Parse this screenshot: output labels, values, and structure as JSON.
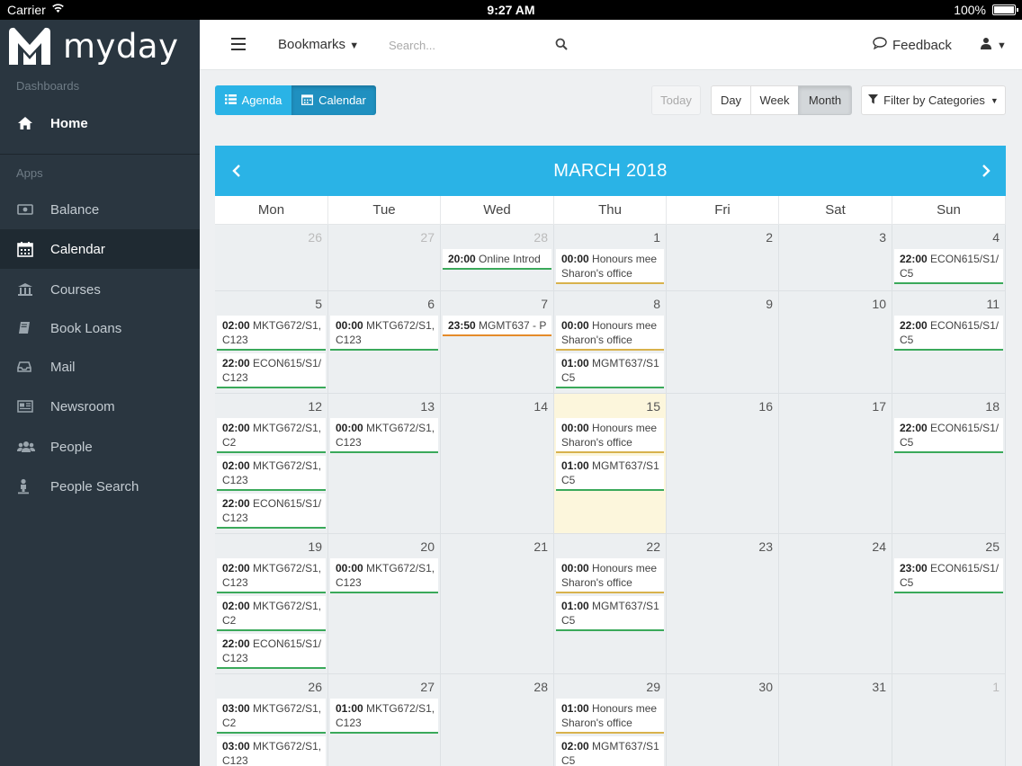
{
  "status_bar": {
    "carrier": "Carrier",
    "time": "9:27 AM",
    "battery": "100%"
  },
  "sidebar": {
    "logo_text": "myday",
    "dashboards_label": "Dashboards",
    "home_label": "Home",
    "apps_label": "Apps",
    "items": [
      {
        "label": "Balance",
        "icon": "balance-icon"
      },
      {
        "label": "Calendar",
        "icon": "calendar-icon"
      },
      {
        "label": "Courses",
        "icon": "courses-icon"
      },
      {
        "label": "Book Loans",
        "icon": "book-icon"
      },
      {
        "label": "Mail",
        "icon": "mail-icon"
      },
      {
        "label": "Newsroom",
        "icon": "newsroom-icon"
      },
      {
        "label": "People",
        "icon": "people-icon"
      },
      {
        "label": "People Search",
        "icon": "people-search-icon"
      }
    ]
  },
  "topbar": {
    "bookmarks": "Bookmarks",
    "search_placeholder": "Search...",
    "feedback": "Feedback"
  },
  "toolbar": {
    "agenda": "Agenda",
    "calendar": "Calendar",
    "today": "Today",
    "day": "Day",
    "week": "Week",
    "month": "Month",
    "filter": "Filter by Categories"
  },
  "calendar": {
    "title": "MARCH 2018",
    "weekdays": [
      "Mon",
      "Tue",
      "Wed",
      "Thu",
      "Fri",
      "Sat",
      "Sun"
    ],
    "today": 15,
    "weeks": [
      [
        {
          "day": "26",
          "muted": true,
          "events": []
        },
        {
          "day": "27",
          "muted": true,
          "events": []
        },
        {
          "day": "28",
          "muted": true,
          "events": [
            {
              "time": "20:00",
              "title": "Online Introd",
              "loc": "",
              "color": "green"
            }
          ]
        },
        {
          "day": "1",
          "events": [
            {
              "time": "00:00",
              "title": "Honours mee",
              "loc": "Sharon's office",
              "color": "gold"
            }
          ]
        },
        {
          "day": "2",
          "events": []
        },
        {
          "day": "3",
          "events": []
        },
        {
          "day": "4",
          "events": [
            {
              "time": "22:00",
              "title": "ECON615/S1/",
              "loc": "C5",
              "color": "green"
            }
          ]
        }
      ],
      [
        {
          "day": "5",
          "events": [
            {
              "time": "02:00",
              "title": "MKTG672/S1,",
              "loc": "C123",
              "color": "green"
            },
            {
              "time": "22:00",
              "title": "ECON615/S1/",
              "loc": "C123",
              "color": "green"
            }
          ]
        },
        {
          "day": "6",
          "events": [
            {
              "time": "00:00",
              "title": "MKTG672/S1,",
              "loc": "C123",
              "color": "green"
            }
          ]
        },
        {
          "day": "7",
          "events": [
            {
              "time": "23:50",
              "title": "MGMT637 - P",
              "loc": "",
              "color": "orange"
            }
          ]
        },
        {
          "day": "8",
          "events": [
            {
              "time": "00:00",
              "title": "Honours mee",
              "loc": "Sharon's office",
              "color": "gold"
            },
            {
              "time": "01:00",
              "title": "MGMT637/S1",
              "loc": "C5",
              "color": "green"
            }
          ]
        },
        {
          "day": "9",
          "events": []
        },
        {
          "day": "10",
          "events": []
        },
        {
          "day": "11",
          "events": [
            {
              "time": "22:00",
              "title": "ECON615/S1/",
              "loc": "C5",
              "color": "green"
            }
          ]
        }
      ],
      [
        {
          "day": "12",
          "events": [
            {
              "time": "02:00",
              "title": "MKTG672/S1,",
              "loc": "C2",
              "color": "green"
            },
            {
              "time": "02:00",
              "title": "MKTG672/S1,",
              "loc": "C123",
              "color": "green"
            },
            {
              "time": "22:00",
              "title": "ECON615/S1/",
              "loc": "C123",
              "color": "green"
            }
          ]
        },
        {
          "day": "13",
          "events": [
            {
              "time": "00:00",
              "title": "MKTG672/S1,",
              "loc": "C123",
              "color": "green"
            }
          ]
        },
        {
          "day": "14",
          "events": []
        },
        {
          "day": "15",
          "events": [
            {
              "time": "00:00",
              "title": "Honours mee",
              "loc": "Sharon's office",
              "color": "gold"
            },
            {
              "time": "01:00",
              "title": "MGMT637/S1",
              "loc": "C5",
              "color": "green"
            }
          ]
        },
        {
          "day": "16",
          "events": []
        },
        {
          "day": "17",
          "events": []
        },
        {
          "day": "18",
          "events": [
            {
              "time": "22:00",
              "title": "ECON615/S1/",
              "loc": "C5",
              "color": "green"
            }
          ]
        }
      ],
      [
        {
          "day": "19",
          "events": [
            {
              "time": "02:00",
              "title": "MKTG672/S1,",
              "loc": "C123",
              "color": "green"
            },
            {
              "time": "02:00",
              "title": "MKTG672/S1,",
              "loc": "C2",
              "color": "green"
            },
            {
              "time": "22:00",
              "title": "ECON615/S1/",
              "loc": "C123",
              "color": "green"
            }
          ]
        },
        {
          "day": "20",
          "events": [
            {
              "time": "00:00",
              "title": "MKTG672/S1,",
              "loc": "C123",
              "color": "green"
            }
          ]
        },
        {
          "day": "21",
          "events": []
        },
        {
          "day": "22",
          "events": [
            {
              "time": "00:00",
              "title": "Honours mee",
              "loc": "Sharon's office",
              "color": "gold"
            },
            {
              "time": "01:00",
              "title": "MGMT637/S1",
              "loc": "C5",
              "color": "green"
            }
          ]
        },
        {
          "day": "23",
          "events": []
        },
        {
          "day": "24",
          "events": []
        },
        {
          "day": "25",
          "events": [
            {
              "time": "23:00",
              "title": "ECON615/S1/",
              "loc": "C5",
              "color": "green"
            }
          ]
        }
      ],
      [
        {
          "day": "26",
          "events": [
            {
              "time": "03:00",
              "title": "MKTG672/S1,",
              "loc": "C2",
              "color": "green"
            },
            {
              "time": "03:00",
              "title": "MKTG672/S1,",
              "loc": "C123",
              "color": "green"
            }
          ]
        },
        {
          "day": "27",
          "events": [
            {
              "time": "01:00",
              "title": "MKTG672/S1,",
              "loc": "C123",
              "color": "green"
            }
          ]
        },
        {
          "day": "28",
          "events": []
        },
        {
          "day": "29",
          "events": [
            {
              "time": "01:00",
              "title": "Honours mee",
              "loc": "Sharon's office",
              "color": "gold"
            },
            {
              "time": "02:00",
              "title": "MGMT637/S1",
              "loc": "C5",
              "color": "green"
            }
          ]
        },
        {
          "day": "30",
          "events": []
        },
        {
          "day": "31",
          "events": []
        },
        {
          "day": "1",
          "muted": true,
          "events": []
        }
      ]
    ]
  }
}
